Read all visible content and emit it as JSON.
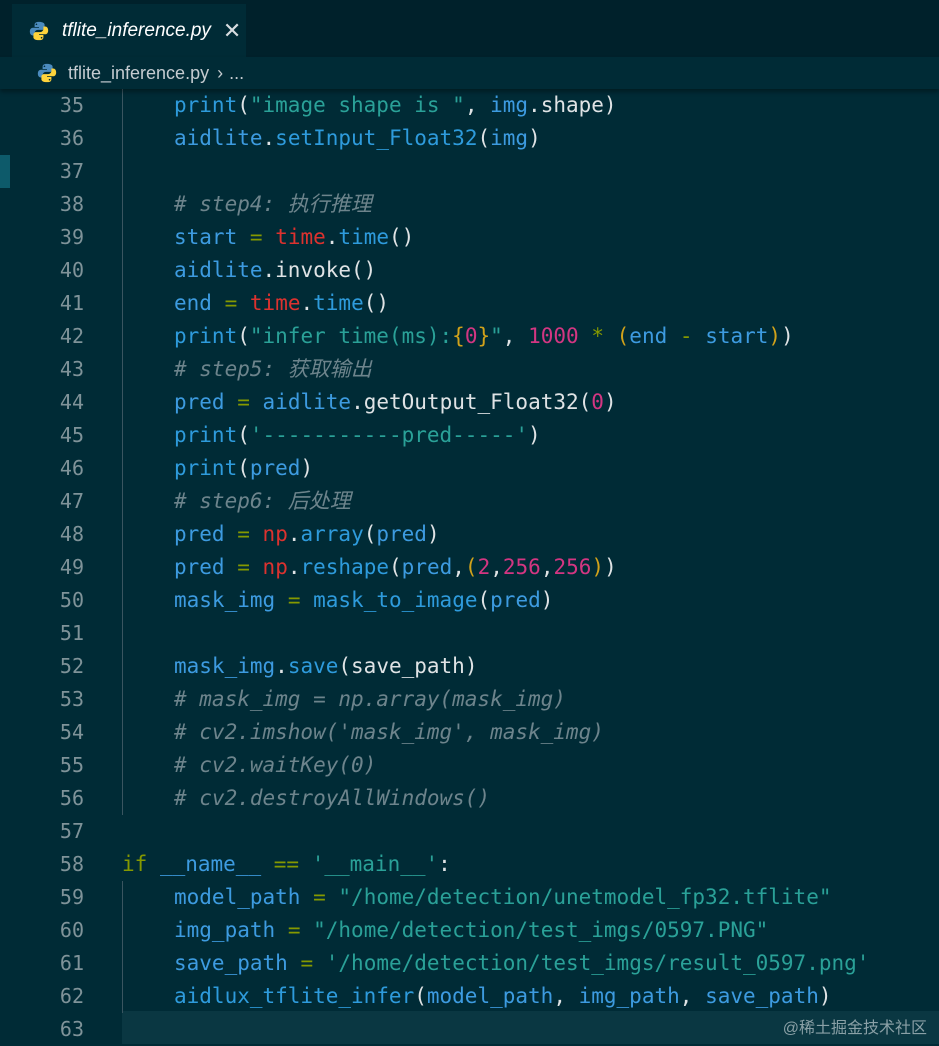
{
  "tab": {
    "title": "tflite_inference.py",
    "close": "✕"
  },
  "breadcrumb": {
    "file": "tflite_inference.py",
    "separator": "›",
    "more": "..."
  },
  "watermark": "@稀土掘金技术社区",
  "lines": [
    {
      "n": "35",
      "indent": 1,
      "tokens": [
        [
          "fn",
          "print"
        ],
        [
          "pun",
          "("
        ],
        [
          "str",
          "\"image shape is \""
        ],
        [
          "pun",
          ", "
        ],
        [
          "var",
          "img"
        ],
        [
          "pun",
          ".shape)"
        ]
      ]
    },
    {
      "n": "36",
      "indent": 1,
      "tokens": [
        [
          "var",
          "aidlite"
        ],
        [
          "pun",
          "."
        ],
        [
          "fn",
          "setInput_Float32"
        ],
        [
          "pun",
          "("
        ],
        [
          "var",
          "img"
        ],
        [
          "pun",
          ")"
        ]
      ]
    },
    {
      "n": "37",
      "indent": 1,
      "tokens": []
    },
    {
      "n": "38",
      "indent": 1,
      "tokens": [
        [
          "com",
          "# step4: 执行推理"
        ]
      ]
    },
    {
      "n": "39",
      "indent": 1,
      "tokens": [
        [
          "var",
          "start"
        ],
        [
          "pun",
          " "
        ],
        [
          "op",
          "="
        ],
        [
          "pun",
          " "
        ],
        [
          "mod",
          "time"
        ],
        [
          "pun",
          "."
        ],
        [
          "fn",
          "time"
        ],
        [
          "pun",
          "()"
        ]
      ]
    },
    {
      "n": "40",
      "indent": 1,
      "tokens": [
        [
          "var",
          "aidlite"
        ],
        [
          "pun",
          ".invoke()"
        ]
      ]
    },
    {
      "n": "41",
      "indent": 1,
      "tokens": [
        [
          "var",
          "end"
        ],
        [
          "pun",
          " "
        ],
        [
          "op",
          "="
        ],
        [
          "pun",
          " "
        ],
        [
          "mod",
          "time"
        ],
        [
          "pun",
          "."
        ],
        [
          "fn",
          "time"
        ],
        [
          "pun",
          "()"
        ]
      ]
    },
    {
      "n": "42",
      "indent": 1,
      "tokens": [
        [
          "fn",
          "print"
        ],
        [
          "pun",
          "("
        ],
        [
          "str",
          "\"infer time(ms):"
        ],
        [
          "br",
          "{"
        ],
        [
          "num",
          "0"
        ],
        [
          "br",
          "}"
        ],
        [
          "str",
          "\""
        ],
        [
          "pun",
          ", "
        ],
        [
          "num",
          "1000"
        ],
        [
          "pun",
          " "
        ],
        [
          "op",
          "*"
        ],
        [
          "pun",
          " "
        ],
        [
          "br",
          "("
        ],
        [
          "var",
          "end"
        ],
        [
          "pun",
          " "
        ],
        [
          "op",
          "-"
        ],
        [
          "pun",
          " "
        ],
        [
          "var",
          "start"
        ],
        [
          "br",
          ")"
        ],
        [
          "pun",
          ")"
        ]
      ]
    },
    {
      "n": "43",
      "indent": 1,
      "tokens": [
        [
          "com",
          "# step5: 获取输出"
        ]
      ]
    },
    {
      "n": "44",
      "indent": 1,
      "tokens": [
        [
          "var",
          "pred"
        ],
        [
          "pun",
          " "
        ],
        [
          "op",
          "="
        ],
        [
          "pun",
          " "
        ],
        [
          "var",
          "aidlite"
        ],
        [
          "pun",
          ".getOutput_Float32("
        ],
        [
          "num",
          "0"
        ],
        [
          "pun",
          ")"
        ]
      ]
    },
    {
      "n": "45",
      "indent": 1,
      "tokens": [
        [
          "fn",
          "print"
        ],
        [
          "pun",
          "("
        ],
        [
          "str",
          "'-----------pred-----'"
        ],
        [
          "pun",
          ")"
        ]
      ]
    },
    {
      "n": "46",
      "indent": 1,
      "tokens": [
        [
          "fn",
          "print"
        ],
        [
          "pun",
          "("
        ],
        [
          "var",
          "pred"
        ],
        [
          "pun",
          ")"
        ]
      ]
    },
    {
      "n": "47",
      "indent": 1,
      "tokens": [
        [
          "com",
          "# step6: 后处理"
        ]
      ]
    },
    {
      "n": "48",
      "indent": 1,
      "tokens": [
        [
          "var",
          "pred"
        ],
        [
          "pun",
          " "
        ],
        [
          "op",
          "="
        ],
        [
          "pun",
          " "
        ],
        [
          "mod",
          "np"
        ],
        [
          "pun",
          "."
        ],
        [
          "fn",
          "array"
        ],
        [
          "pun",
          "("
        ],
        [
          "var",
          "pred"
        ],
        [
          "pun",
          ")"
        ]
      ]
    },
    {
      "n": "49",
      "indent": 1,
      "tokens": [
        [
          "var",
          "pred"
        ],
        [
          "pun",
          " "
        ],
        [
          "op",
          "="
        ],
        [
          "pun",
          " "
        ],
        [
          "mod",
          "np"
        ],
        [
          "pun",
          "."
        ],
        [
          "fn",
          "reshape"
        ],
        [
          "pun",
          "("
        ],
        [
          "var",
          "pred"
        ],
        [
          "pun",
          ","
        ],
        [
          "br",
          "("
        ],
        [
          "num",
          "2"
        ],
        [
          "pun",
          ","
        ],
        [
          "num",
          "256"
        ],
        [
          "pun",
          ","
        ],
        [
          "num",
          "256"
        ],
        [
          "br",
          ")"
        ],
        [
          "pun",
          ")"
        ]
      ]
    },
    {
      "n": "50",
      "indent": 1,
      "tokens": [
        [
          "var",
          "mask_img"
        ],
        [
          "pun",
          " "
        ],
        [
          "op",
          "="
        ],
        [
          "pun",
          " "
        ],
        [
          "fn",
          "mask_to_image"
        ],
        [
          "pun",
          "("
        ],
        [
          "var",
          "pred"
        ],
        [
          "pun",
          ")"
        ]
      ]
    },
    {
      "n": "51",
      "indent": 1,
      "tokens": []
    },
    {
      "n": "52",
      "indent": 1,
      "tokens": [
        [
          "var",
          "mask_img"
        ],
        [
          "pun",
          "."
        ],
        [
          "fn",
          "save"
        ],
        [
          "pun",
          "(save_path)"
        ]
      ]
    },
    {
      "n": "53",
      "indent": 1,
      "tokens": [
        [
          "com",
          "# mask_img = np.array(mask_img)"
        ]
      ]
    },
    {
      "n": "54",
      "indent": 1,
      "tokens": [
        [
          "com",
          "# cv2.imshow('mask_img', mask_img)"
        ]
      ]
    },
    {
      "n": "55",
      "indent": 1,
      "tokens": [
        [
          "com",
          "# cv2.waitKey(0)"
        ]
      ]
    },
    {
      "n": "56",
      "indent": 1,
      "tokens": [
        [
          "com",
          "# cv2.destroyAllWindows()"
        ]
      ]
    },
    {
      "n": "57",
      "indent": 0,
      "tokens": []
    },
    {
      "n": "58",
      "indent": 0,
      "tokens": [
        [
          "kw",
          "if"
        ],
        [
          "pun",
          " "
        ],
        [
          "var",
          "__name__"
        ],
        [
          "pun",
          " "
        ],
        [
          "op",
          "=="
        ],
        [
          "pun",
          " "
        ],
        [
          "str",
          "'__main__'"
        ],
        [
          "pun",
          ":"
        ]
      ]
    },
    {
      "n": "59",
      "indent": 1,
      "tokens": [
        [
          "var",
          "model_path"
        ],
        [
          "pun",
          " "
        ],
        [
          "op",
          "="
        ],
        [
          "pun",
          " "
        ],
        [
          "str",
          "\"/home/detection/unetmodel_fp32.tflite\""
        ]
      ]
    },
    {
      "n": "60",
      "indent": 1,
      "tokens": [
        [
          "var",
          "img_path"
        ],
        [
          "pun",
          " "
        ],
        [
          "op",
          "="
        ],
        [
          "pun",
          " "
        ],
        [
          "str",
          "\"/home/detection/test_imgs/0597.PNG\""
        ]
      ]
    },
    {
      "n": "61",
      "indent": 1,
      "tokens": [
        [
          "var",
          "save_path"
        ],
        [
          "pun",
          " "
        ],
        [
          "op",
          "="
        ],
        [
          "pun",
          " "
        ],
        [
          "str",
          "'/home/detection/test_imgs/result_0597.png'"
        ]
      ]
    },
    {
      "n": "62",
      "indent": 1,
      "tokens": [
        [
          "fn",
          "aidlux_tflite_infer"
        ],
        [
          "pun",
          "("
        ],
        [
          "var",
          "model_path"
        ],
        [
          "pun",
          ", "
        ],
        [
          "var",
          "img_path"
        ],
        [
          "pun",
          ", "
        ],
        [
          "var",
          "save_path"
        ],
        [
          "pun",
          ")"
        ]
      ]
    },
    {
      "n": "63",
      "indent": 0,
      "tokens": []
    }
  ]
}
